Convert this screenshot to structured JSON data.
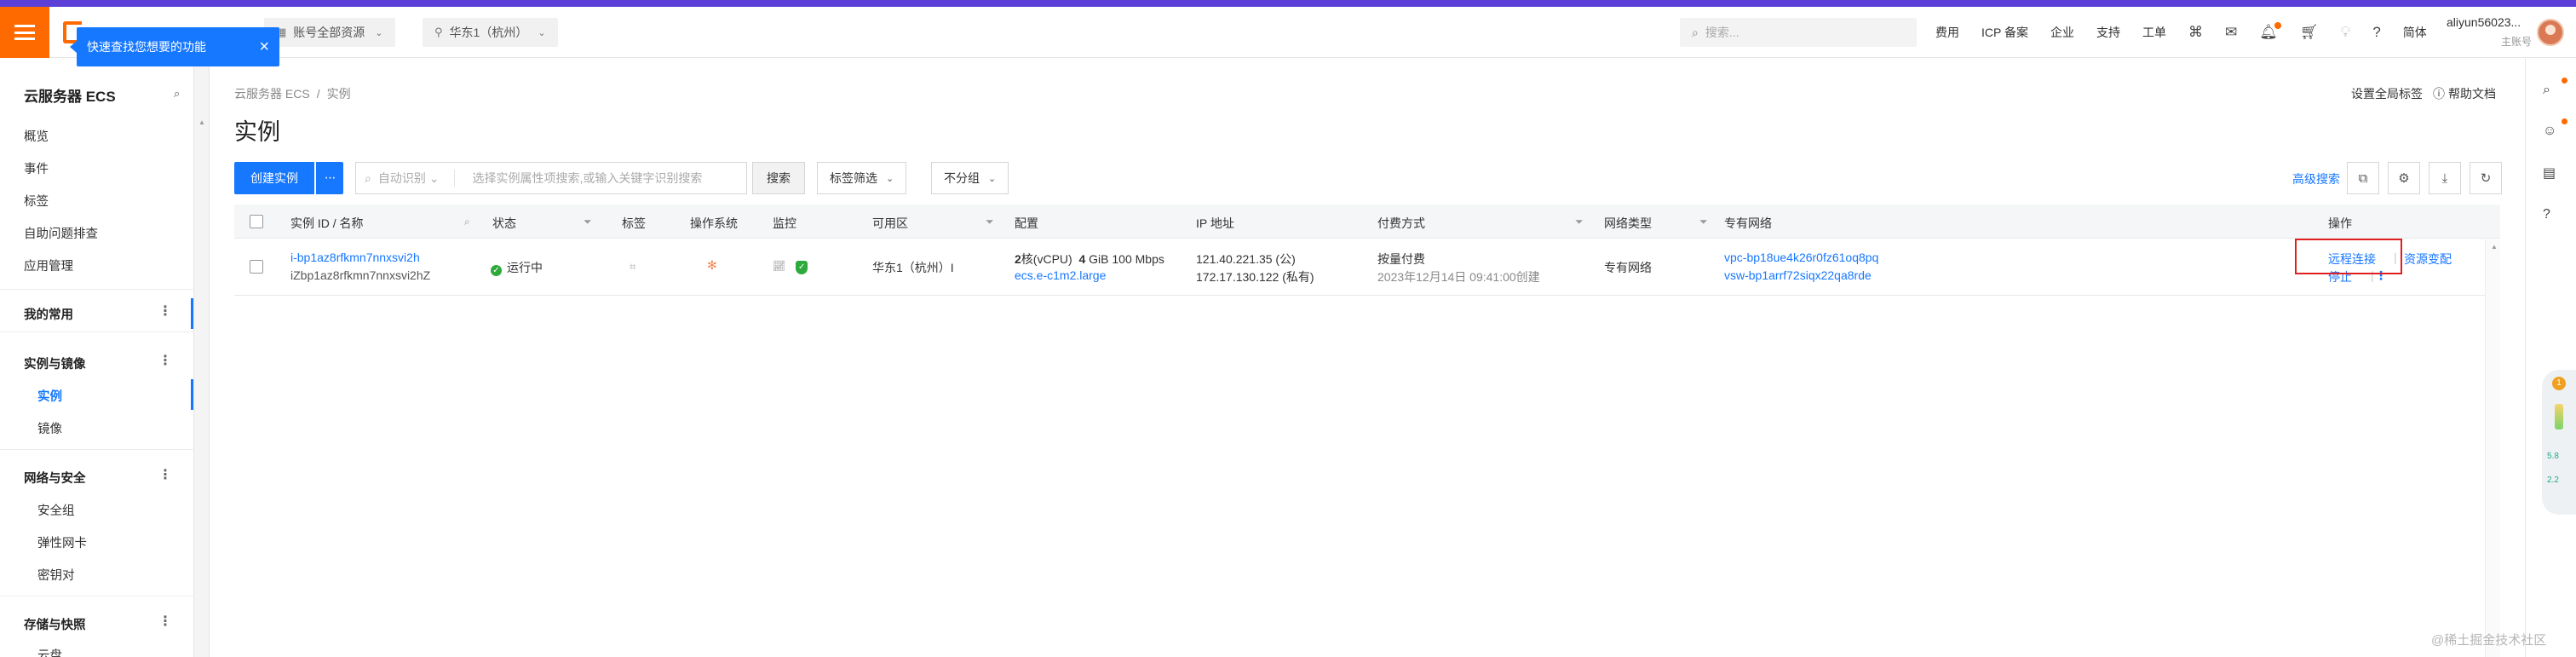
{
  "top_nav": {
    "account_resources": "账号全部资源",
    "region": "华东1（杭州）",
    "search_placeholder": "搜索...",
    "links": [
      "费用",
      "ICP 备案",
      "企业",
      "支持",
      "工单"
    ],
    "language": "简体",
    "user_name": "aliyun56023...",
    "user_role": "主账号"
  },
  "tooltip": {
    "text": "快速查找您想要的功能",
    "close": "×"
  },
  "sidebar": {
    "title": "云服务器 ECS",
    "items": [
      "概览",
      "事件",
      "标签",
      "自助问题排查",
      "应用管理"
    ],
    "my_common": "我的常用",
    "groups": [
      {
        "label": "实例与镜像",
        "items": [
          "实例",
          "镜像"
        ]
      },
      {
        "label": "网络与安全",
        "items": [
          "安全组",
          "弹性网卡",
          "密钥对"
        ]
      },
      {
        "label": "存储与快照",
        "items": [
          "云盘"
        ]
      }
    ],
    "active_item": "实例"
  },
  "breadcrumb": [
    "云服务器 ECS",
    "实例"
  ],
  "page_title": "实例",
  "top_right": {
    "global_tags": "设置全局标签",
    "help": "帮助文档"
  },
  "toolbar": {
    "create_label": "创建实例",
    "more_label": "···",
    "search_segment": "自动识别",
    "search_placeholder": "选择实例属性项搜索,或输入关键字识别搜索",
    "search_button": "搜索",
    "tag_filter": "标签筛选",
    "group_label": "不分组",
    "advanced_search": "高级搜索"
  },
  "table": {
    "columns": [
      "实例 ID / 名称",
      "状态",
      "标签",
      "操作系统",
      "监控",
      "可用区",
      "配置",
      "IP 地址",
      "付费方式",
      "网络类型",
      "专有网络",
      "操作"
    ],
    "rows": [
      {
        "instance_id": "i-bp1az8rfkmn7nnxsvi2h",
        "instance_name": "iZbp1az8rfkmn7nnxsvi2hZ",
        "status": "运行中",
        "zone": "华东1（杭州）I",
        "config_cpu": "2",
        "config_cpu_unit": "核(vCPU)",
        "config_mem": "4",
        "config_mem_unit": "GiB",
        "config_bw": "100 Mbps",
        "instance_type": "ecs.e-c1m2.large",
        "ip_public": "121.40.221.35 (公)",
        "ip_private": "172.17.130.122 (私有)",
        "billing": "按量付费",
        "created": "2023年12月14日 09:41:00创建",
        "network_type": "专有网络",
        "vpc": "vpc-bp18ue4k26r0fz61oq8pq",
        "vswitch": "vsw-bp1arrf72siqx22qa8rde",
        "op_remote": "远程连接",
        "op_resize": "资源变配",
        "op_stop": "停止",
        "op_more": "⋮"
      }
    ]
  },
  "float_widget": {
    "badge": "1",
    "stat1": "5.8",
    "stat2": "2.2"
  },
  "watermark": "@稀土掘金技术社区",
  "colors": {
    "brand_orange": "#ff6a00",
    "primary_blue": "#1677ff",
    "status_green": "#2eaa3c",
    "highlight_red": "#e02020"
  }
}
